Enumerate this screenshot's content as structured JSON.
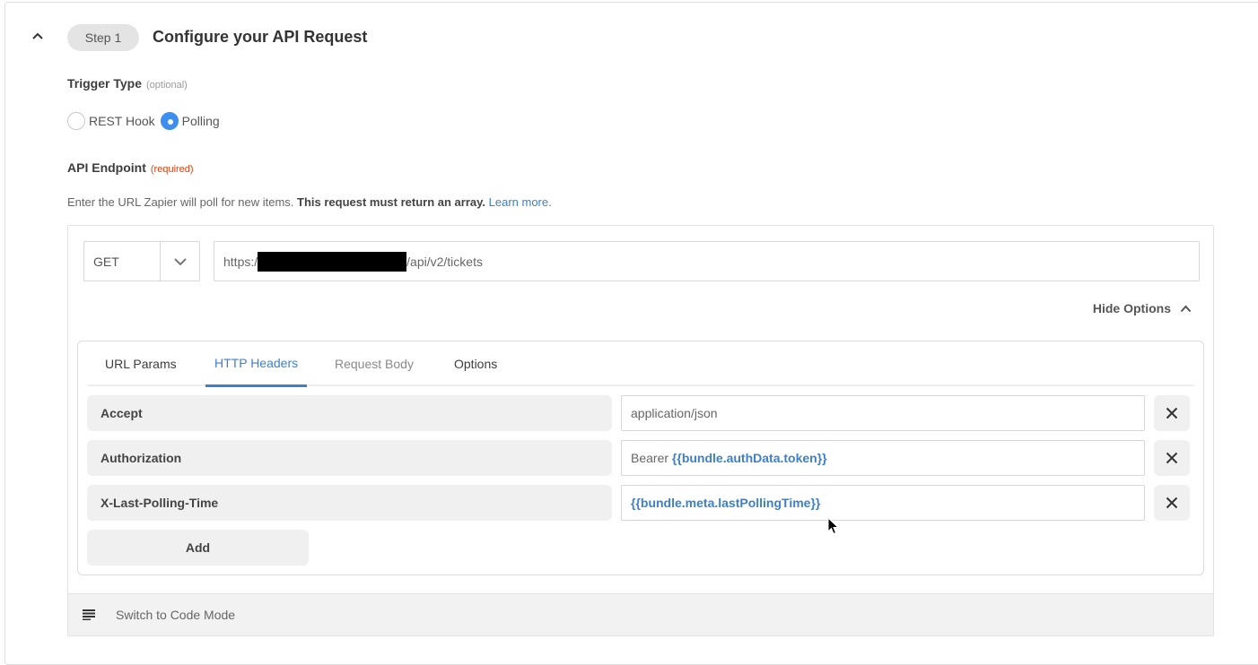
{
  "step": {
    "pill": "Step 1",
    "title": "Configure your API Request"
  },
  "trigger_type": {
    "label": "Trigger Type",
    "hint": "(optional)",
    "options": [
      "REST Hook",
      "Polling"
    ],
    "selected": "Polling"
  },
  "api_endpoint": {
    "label": "API Endpoint",
    "hint": "(required)",
    "help_plain": "Enter the URL Zapier will poll for new items.",
    "help_bold": "This request must return an array.",
    "help_link": "Learn more",
    "help_end": ".",
    "method": "GET",
    "url_prefix": "https:/",
    "url_suffix": "/api/v2/tickets",
    "hide_options": "Hide Options"
  },
  "tabs": {
    "url_params": "URL Params",
    "http_headers": "HTTP Headers",
    "request_body": "Request Body",
    "options": "Options",
    "active": "HTTP Headers"
  },
  "headers": [
    {
      "key": "Accept",
      "value_text": "application/json",
      "value_token": ""
    },
    {
      "key": "Authorization",
      "value_text": "Bearer",
      "value_token": "{{bundle.authData.token}}"
    },
    {
      "key": "X-Last-Polling-Time",
      "value_text": "",
      "value_token": "{{bundle.meta.lastPollingTime}}"
    }
  ],
  "add_label": "Add",
  "code_mode_label": "Switch to Code Mode",
  "colors": {
    "accent": "#3b7fcd",
    "radio_checked": "#3d8ef0",
    "required": "#d84315"
  }
}
